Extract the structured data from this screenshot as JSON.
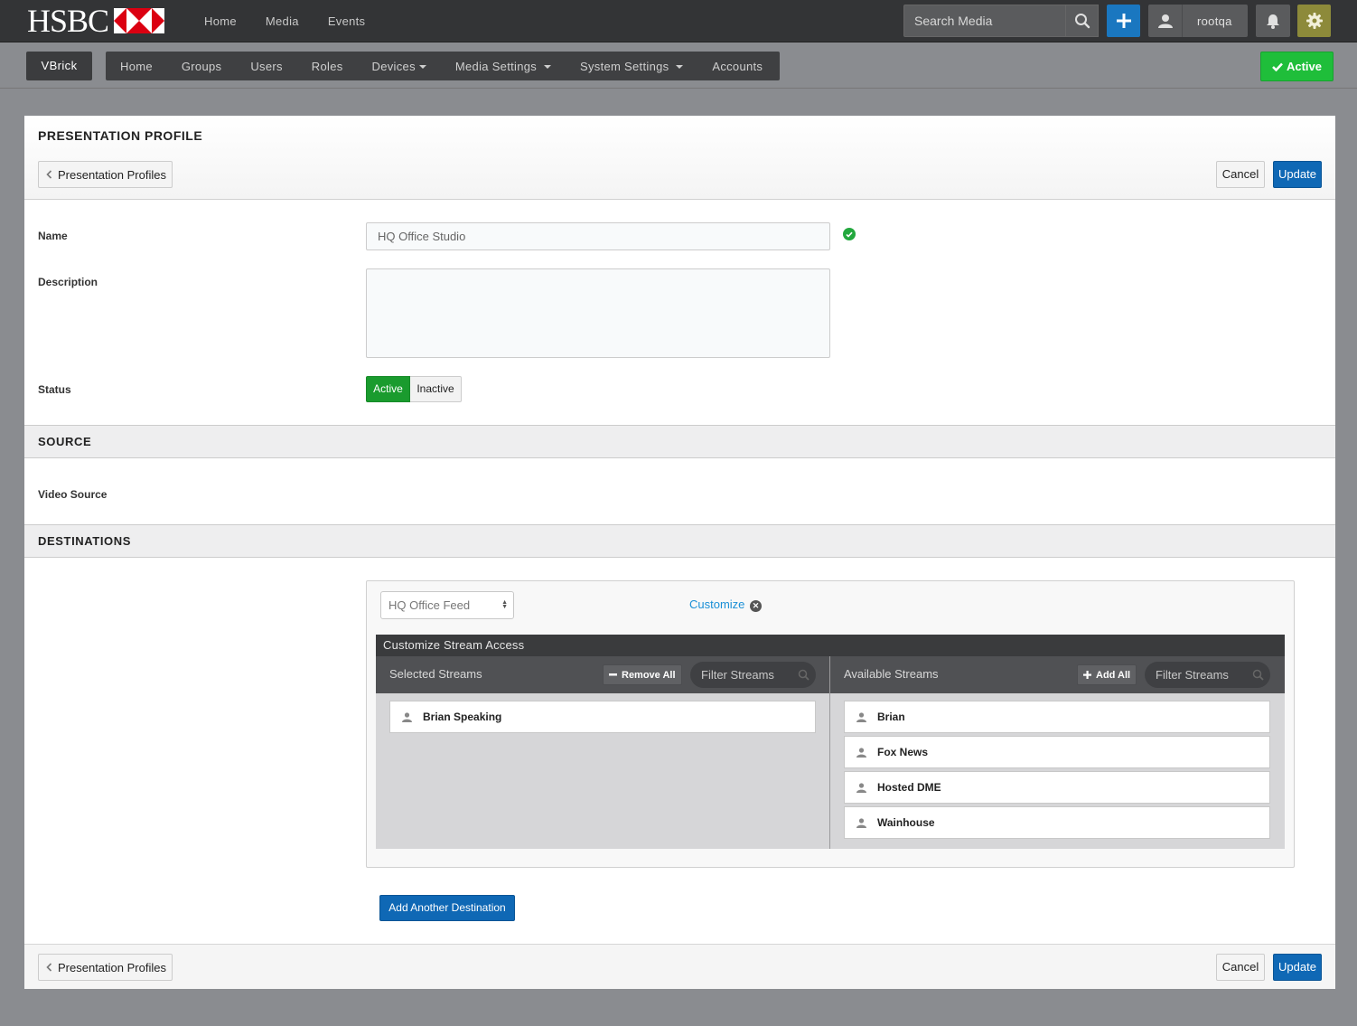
{
  "topbar": {
    "brand": "HSBC",
    "nav": [
      "Home",
      "Media",
      "Events"
    ],
    "search_placeholder": "Search Media",
    "user": "rootqa",
    "colors": {
      "plus": "#1a77c0",
      "gear": "#8d8a3a"
    }
  },
  "subnav": {
    "account": "VBrick",
    "items": [
      "Home",
      "Groups",
      "Users",
      "Roles",
      "Devices",
      "Media Settings",
      "System Settings",
      "Accounts"
    ],
    "status_label": "Active",
    "status_color": "#1fbe3a"
  },
  "page": {
    "title": "PRESENTATION PROFILE",
    "back_label": "Presentation Profiles",
    "cancel_label": "Cancel",
    "update_label": "Update"
  },
  "form": {
    "name_label": "Name",
    "name_value": "HQ Office Studio",
    "description_label": "Description",
    "description_value": "",
    "status_label": "Status",
    "status_options": [
      "Active",
      "Inactive"
    ],
    "status_selected": "Active"
  },
  "source": {
    "section_title": "SOURCE",
    "video_source_label": "Video Source"
  },
  "destinations": {
    "section_title": "DESTINATIONS",
    "feed_selected": "HQ Office Feed",
    "customize_label": "Customize",
    "stream_access_title": "Customize Stream Access",
    "selected": {
      "title": "Selected Streams",
      "remove_all": "Remove All",
      "filter_placeholder": "Filter Streams",
      "streams": [
        "Brian Speaking"
      ]
    },
    "available": {
      "title": "Available Streams",
      "add_all": "Add All",
      "filter_placeholder": "Filter Streams",
      "streams": [
        "Brian",
        "Fox News",
        "Hosted DME",
        "Wainhouse"
      ]
    },
    "add_another_label": "Add Another Destination"
  }
}
